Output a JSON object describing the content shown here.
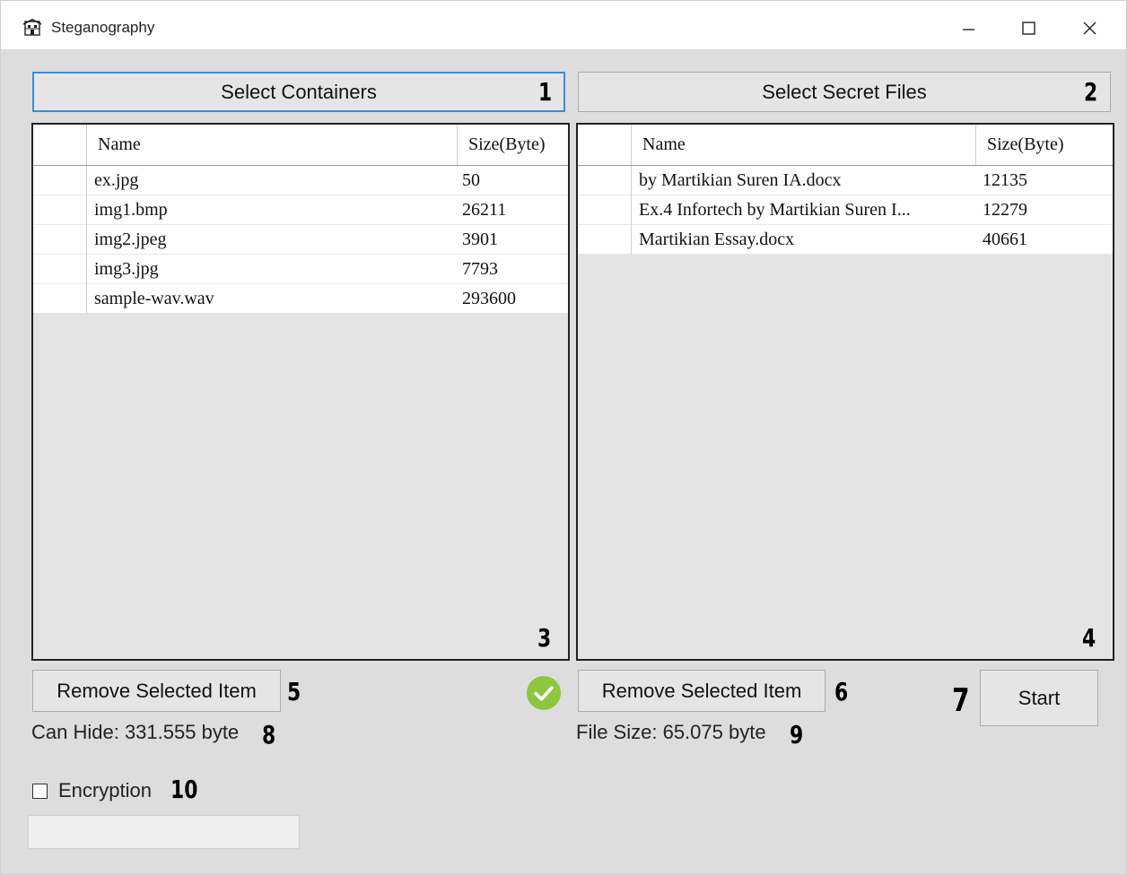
{
  "window": {
    "title": "Steganography",
    "icon": "building-app-icon",
    "controls": [
      "minimize-icon",
      "maximize-icon",
      "close-icon"
    ]
  },
  "buttons": {
    "select_containers": "Select Containers",
    "select_secret_files": "Select Secret Files",
    "remove_left": "Remove Selected Item",
    "remove_right": "Remove Selected Item",
    "start": "Start"
  },
  "annotations": {
    "n1": "1",
    "n2": "2",
    "n3": "3",
    "n4": "4",
    "n5": "5",
    "n6": "6",
    "n7": "7",
    "n8": "8",
    "n9": "9",
    "n10": "10"
  },
  "containers_table": {
    "headers": [
      "Name",
      "Size(Byte)"
    ],
    "rows": [
      {
        "name": "ex.jpg",
        "size": "50"
      },
      {
        "name": "img1.bmp",
        "size": "26211"
      },
      {
        "name": "img2.jpeg",
        "size": "3901"
      },
      {
        "name": "img3.jpg",
        "size": "7793"
      },
      {
        "name": "sample-wav.wav",
        "size": "293600"
      }
    ]
  },
  "secret_table": {
    "headers": [
      "Name",
      "Size(Byte)"
    ],
    "rows": [
      {
        "name": "by Martikian Suren IA.docx",
        "size": "12135"
      },
      {
        "name": "Ex.4 Infortech by Martikian Suren I...",
        "size": "12279"
      },
      {
        "name": "Martikian Essay.docx",
        "size": "40661"
      }
    ]
  },
  "status": {
    "can_hide": "Can Hide: 331.555 byte",
    "file_size": "File Size: 65.075 byte",
    "ok_icon": "check-circle-icon",
    "ok_color": "#8dc63f"
  },
  "encryption": {
    "label": "Encryption",
    "checked": false,
    "password_value": ""
  },
  "colors": {
    "focus_border": "#3c8ad8",
    "window_bg": "#dddddd"
  }
}
